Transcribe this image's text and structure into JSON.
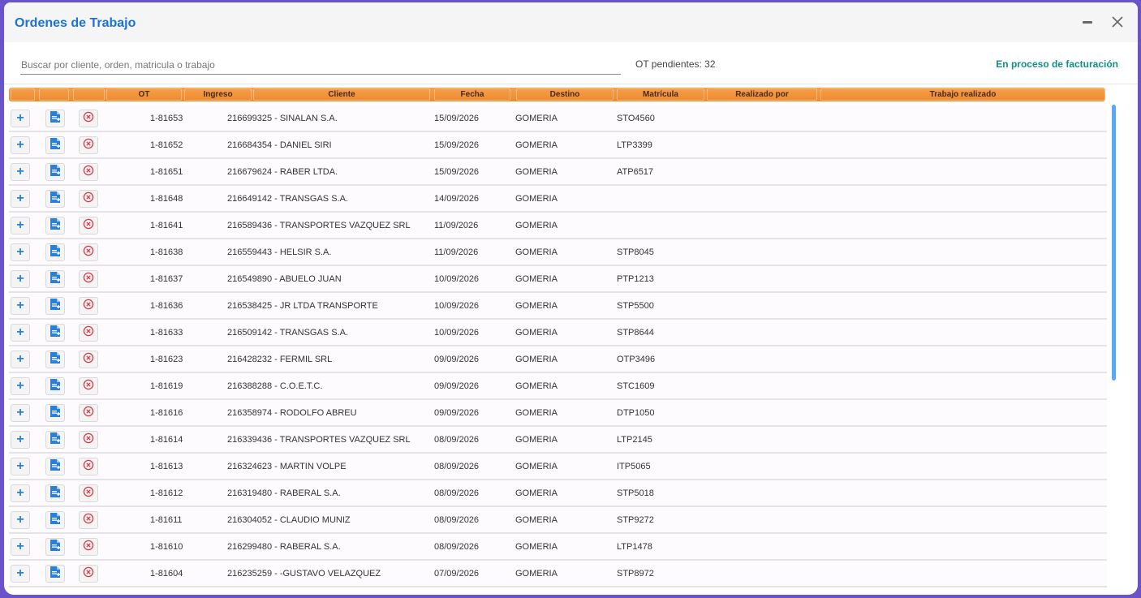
{
  "window": {
    "title": "Ordenes de Trabajo"
  },
  "toolbar": {
    "search_placeholder": "Buscar por cliente, orden, matricula o trabajo",
    "pending": "OT pendientes: 32",
    "billing_link": "En proceso de facturación"
  },
  "colors": {
    "title": "#1a73d9",
    "header_orange": "#f0902f",
    "billing_link": "#0f8f86",
    "scrollbar": "#5aa9f2",
    "border_frame": "#6a52c9"
  },
  "icons": {
    "add": "plus-icon",
    "document": "document-add-icon",
    "cancel": "cancel-circle-icon",
    "minimize": "minimize-icon",
    "close": "close-icon"
  },
  "columns": [
    "",
    "",
    "",
    "OT",
    "Ingreso",
    "Cliente",
    "Fecha",
    "Destino",
    "Matrícula",
    "Realizado por",
    "Trabajo realizado"
  ],
  "rows": [
    {
      "ot": "1-81653",
      "ingreso": "216699325 - SINALAN S.A.",
      "fecha": "15/09/2026",
      "destino": "GOMERIA",
      "matricula": "STO4560"
    },
    {
      "ot": "1-81652",
      "ingreso": "216684354 - DANIEL SIRI",
      "fecha": "15/09/2026",
      "destino": "GOMERIA",
      "matricula": "LTP3399"
    },
    {
      "ot": "1-81651",
      "ingreso": "216679624 - RABER LTDA.",
      "fecha": "15/09/2026",
      "destino": "GOMERIA",
      "matricula": "ATP6517"
    },
    {
      "ot": "1-81648",
      "ingreso": "216649142 - TRANSGAS S.A.",
      "fecha": "14/09/2026",
      "destino": "GOMERIA",
      "matricula": ""
    },
    {
      "ot": "1-81641",
      "ingreso": "216589436 - TRANSPORTES VAZQUEZ SRL",
      "fecha": "11/09/2026",
      "destino": "GOMERIA",
      "matricula": ""
    },
    {
      "ot": "1-81638",
      "ingreso": "216559443 - HELSIR S.A.",
      "fecha": "11/09/2026",
      "destino": "GOMERIA",
      "matricula": "STP8045"
    },
    {
      "ot": "1-81637",
      "ingreso": "216549890 - ABUELO JUAN",
      "fecha": "10/09/2026",
      "destino": "GOMERIA",
      "matricula": "PTP1213"
    },
    {
      "ot": "1-81636",
      "ingreso": "216538425 - JR LTDA TRANSPORTE",
      "fecha": "10/09/2026",
      "destino": "GOMERIA",
      "matricula": "STP5500"
    },
    {
      "ot": "1-81633",
      "ingreso": "216509142 - TRANSGAS S.A.",
      "fecha": "10/09/2026",
      "destino": "GOMERIA",
      "matricula": "STP8644"
    },
    {
      "ot": "1-81623",
      "ingreso": "216428232 - FERMIL SRL",
      "fecha": "09/09/2026",
      "destino": "GOMERIA",
      "matricula": "OTP3496"
    },
    {
      "ot": "1-81619",
      "ingreso": "216388288 - C.O.E.T.C.",
      "fecha": "09/09/2026",
      "destino": "GOMERIA",
      "matricula": "STC1609"
    },
    {
      "ot": "1-81616",
      "ingreso": "216358974 - RODOLFO ABREU",
      "fecha": "09/09/2026",
      "destino": "GOMERIA",
      "matricula": "DTP1050"
    },
    {
      "ot": "1-81614",
      "ingreso": "216339436 - TRANSPORTES VAZQUEZ SRL",
      "fecha": "08/09/2026",
      "destino": "GOMERIA",
      "matricula": "LTP2145"
    },
    {
      "ot": "1-81613",
      "ingreso": "216324623 - MARTIN VOLPE",
      "fecha": "08/09/2026",
      "destino": "GOMERIA",
      "matricula": "ITP5065"
    },
    {
      "ot": "1-81612",
      "ingreso": "216319480 - RABERAL S.A.",
      "fecha": "08/09/2026",
      "destino": "GOMERIA",
      "matricula": "STP5018"
    },
    {
      "ot": "1-81611",
      "ingreso": "216304052 - CLAUDIO MUNIZ",
      "fecha": "08/09/2026",
      "destino": "GOMERIA",
      "matricula": "STP9272"
    },
    {
      "ot": "1-81610",
      "ingreso": "216299480 - RABERAL S.A.",
      "fecha": "08/09/2026",
      "destino": "GOMERIA",
      "matricula": "LTP1478"
    },
    {
      "ot": "1-81604",
      "ingreso": "216235259 - -GUSTAVO VELAZQUEZ",
      "fecha": "07/09/2026",
      "destino": "GOMERIA",
      "matricula": "STP8972"
    }
  ]
}
